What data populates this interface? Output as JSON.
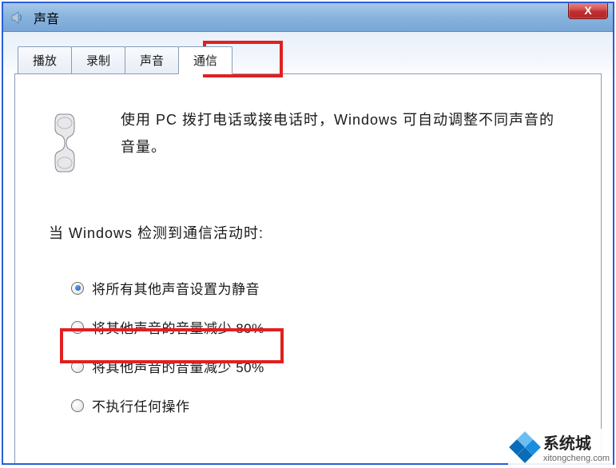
{
  "window": {
    "title": "声音",
    "close_label": "X"
  },
  "tabs": {
    "items": [
      {
        "label": "播放",
        "active": false
      },
      {
        "label": "录制",
        "active": false
      },
      {
        "label": "声音",
        "active": false
      },
      {
        "label": "通信",
        "active": true
      }
    ]
  },
  "content": {
    "description": "使用 PC 拨打电话或接电话时，Windows 可自动调整不同声音的音量。",
    "section_heading": "当 Windows 检测到通信活动时:",
    "options": [
      {
        "label": "将所有其他声音设置为静音",
        "checked": true
      },
      {
        "label": "将其他声音的音量减少 80%",
        "checked": false
      },
      {
        "label": "将其他声音的音量减少 50%",
        "checked": false
      },
      {
        "label": "不执行任何操作",
        "checked": false
      }
    ]
  },
  "watermark": {
    "main": "系统城",
    "sub": "xitongcheng.com"
  }
}
